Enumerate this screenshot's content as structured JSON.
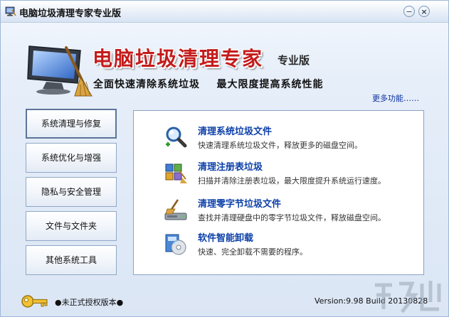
{
  "window": {
    "title": "电脑垃圾清理专家专业版",
    "minimize_glyph": "−",
    "close_glyph": "×"
  },
  "banner": {
    "title": "电脑垃圾清理专家",
    "edition": "专业版",
    "slogan": "全面快速清除系统垃圾    最大限度提高系统性能",
    "more_link": "更多功能……"
  },
  "nav": {
    "items": [
      {
        "label": "系统清理与修复",
        "active": true
      },
      {
        "label": "系统优化与增强",
        "active": false
      },
      {
        "label": "隐私与安全管理",
        "active": false
      },
      {
        "label": "文件与文件夹",
        "active": false
      },
      {
        "label": "其他系统工具",
        "active": false
      }
    ]
  },
  "tasks": [
    {
      "title": "清理系统垃圾文件",
      "desc": "快速清理系统垃圾文件，释放更多的磁盘空间。",
      "icon": "magnifier-icon"
    },
    {
      "title": "清理注册表垃圾",
      "desc": "扫描并清除注册表垃圾，最大限度提升系统运行速度。",
      "icon": "registry-icon"
    },
    {
      "title": "清理零字节垃圾文件",
      "desc": "查找并清理硬盘中的零字节垃圾文件，释放磁盘空间。",
      "icon": "broom-disk-icon"
    },
    {
      "title": "软件智能卸载",
      "desc": "快速、完全卸载不需要的程序。",
      "icon": "uninstall-cd-icon"
    }
  ],
  "footer": {
    "license": "●未正式授权版本●",
    "version": "Version:9.98 Build 20130828"
  },
  "colors": {
    "accent": "#0b3fa8",
    "banner_red": "#c41b1b",
    "panel_border": "#8aa3c4"
  }
}
